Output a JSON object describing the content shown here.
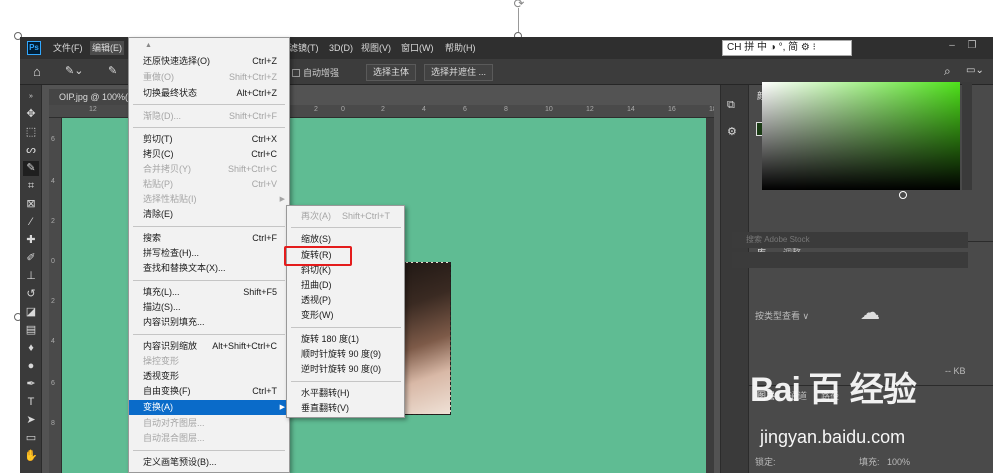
{
  "menubar": {
    "logo": "Ps",
    "items": [
      "文件(F)",
      "编辑(E)",
      "滤镜(T)",
      "3D(D)",
      "视图(V)",
      "窗口(W)",
      "帮助(H)"
    ],
    "ime": "CH 拼 中 ◑ °, 简 ⚙ ⁝"
  },
  "options": {
    "auto_enhance": "自动增强",
    "select_subject": "选择主体",
    "select_mask": "选择并遮住 ..."
  },
  "document": {
    "tab_title": "OIP.jpg @ 100%(",
    "ruler_h": [
      "12",
      "10",
      "8",
      "6",
      "4",
      "2",
      "0",
      "2",
      "4",
      "6",
      "8",
      "10",
      "12",
      "14",
      "16",
      "18"
    ],
    "ruler_v": [
      "6",
      "4",
      "2",
      "0",
      "2",
      "4",
      "6",
      "8"
    ]
  },
  "edit_menu": {
    "items": [
      {
        "label": "还原快速选择(O)",
        "shortcut": "Ctrl+Z",
        "disabled": false
      },
      {
        "label": "重做(O)",
        "shortcut": "Shift+Ctrl+Z",
        "disabled": true
      },
      {
        "label": "切换最终状态",
        "shortcut": "Alt+Ctrl+Z",
        "disabled": false
      },
      {
        "label": "渐隐(D)...",
        "shortcut": "Shift+Ctrl+F",
        "disabled": true
      },
      {
        "label": "剪切(T)",
        "shortcut": "Ctrl+X",
        "disabled": false
      },
      {
        "label": "拷贝(C)",
        "shortcut": "Ctrl+C",
        "disabled": false
      },
      {
        "label": "合并拷贝(Y)",
        "shortcut": "Shift+Ctrl+C",
        "disabled": true
      },
      {
        "label": "粘贴(P)",
        "shortcut": "Ctrl+V",
        "disabled": true
      },
      {
        "label": "选择性粘贴(I)",
        "shortcut": "",
        "disabled": true
      },
      {
        "label": "清除(E)",
        "shortcut": "",
        "disabled": false
      },
      {
        "label": "搜索",
        "shortcut": "Ctrl+F",
        "disabled": false
      },
      {
        "label": "拼写检查(H)...",
        "shortcut": "",
        "disabled": false
      },
      {
        "label": "查找和替换文本(X)...",
        "shortcut": "",
        "disabled": false
      },
      {
        "label": "填充(L)...",
        "shortcut": "Shift+F5",
        "disabled": false
      },
      {
        "label": "描边(S)...",
        "shortcut": "",
        "disabled": false
      },
      {
        "label": "内容识别填充...",
        "shortcut": "",
        "disabled": false
      },
      {
        "label": "内容识别缩放",
        "shortcut": "Alt+Shift+Ctrl+C",
        "disabled": false
      },
      {
        "label": "操控变形",
        "shortcut": "",
        "disabled": true
      },
      {
        "label": "透视变形",
        "shortcut": "",
        "disabled": false
      },
      {
        "label": "自由变换(F)",
        "shortcut": "Ctrl+T",
        "disabled": false
      },
      {
        "label": "变换(A)",
        "shortcut": "",
        "disabled": false
      },
      {
        "label": "自动对齐图层...",
        "shortcut": "",
        "disabled": true
      },
      {
        "label": "自动混合图层...",
        "shortcut": "",
        "disabled": true
      },
      {
        "label": "定义画笔预设(B)...",
        "shortcut": "",
        "disabled": false
      }
    ]
  },
  "transform_menu": {
    "items": [
      {
        "label": "再次(A)",
        "shortcut": "Shift+Ctrl+T",
        "disabled": true
      },
      {
        "label": "缩放(S)",
        "shortcut": "",
        "disabled": false
      },
      {
        "label": "旋转(R)",
        "shortcut": "",
        "disabled": false
      },
      {
        "label": "斜切(K)",
        "shortcut": "",
        "disabled": false
      },
      {
        "label": "扭曲(D)",
        "shortcut": "",
        "disabled": false
      },
      {
        "label": "透视(P)",
        "shortcut": "",
        "disabled": false
      },
      {
        "label": "变形(W)",
        "shortcut": "",
        "disabled": false
      },
      {
        "label": "旋转 180 度(1)",
        "shortcut": "",
        "disabled": false
      },
      {
        "label": "顺时针旋转 90 度(9)",
        "shortcut": "",
        "disabled": false
      },
      {
        "label": "逆时针旋转 90 度(0)",
        "shortcut": "",
        "disabled": false
      },
      {
        "label": "水平翻转(H)",
        "shortcut": "",
        "disabled": false
      },
      {
        "label": "垂直翻转(V)",
        "shortcut": "",
        "disabled": false
      }
    ]
  },
  "panels": {
    "color_tab": "颜色",
    "swatches_tab": "色板",
    "library_tab": "库",
    "adjust_tab": "调整",
    "search_placeholder": "搜索 Adobe Stock",
    "group_by": "按类型查看 ∨",
    "kb": "-- KB",
    "layers_tab": "图层",
    "channels_tab": "通道",
    "paths_tab": "路径",
    "lock_label": "锁定:",
    "fill_label": "填充:",
    "fill_value": "100%"
  },
  "watermark": {
    "logo": "Bai 百 经验",
    "url": "jingyan.baidu.com"
  }
}
